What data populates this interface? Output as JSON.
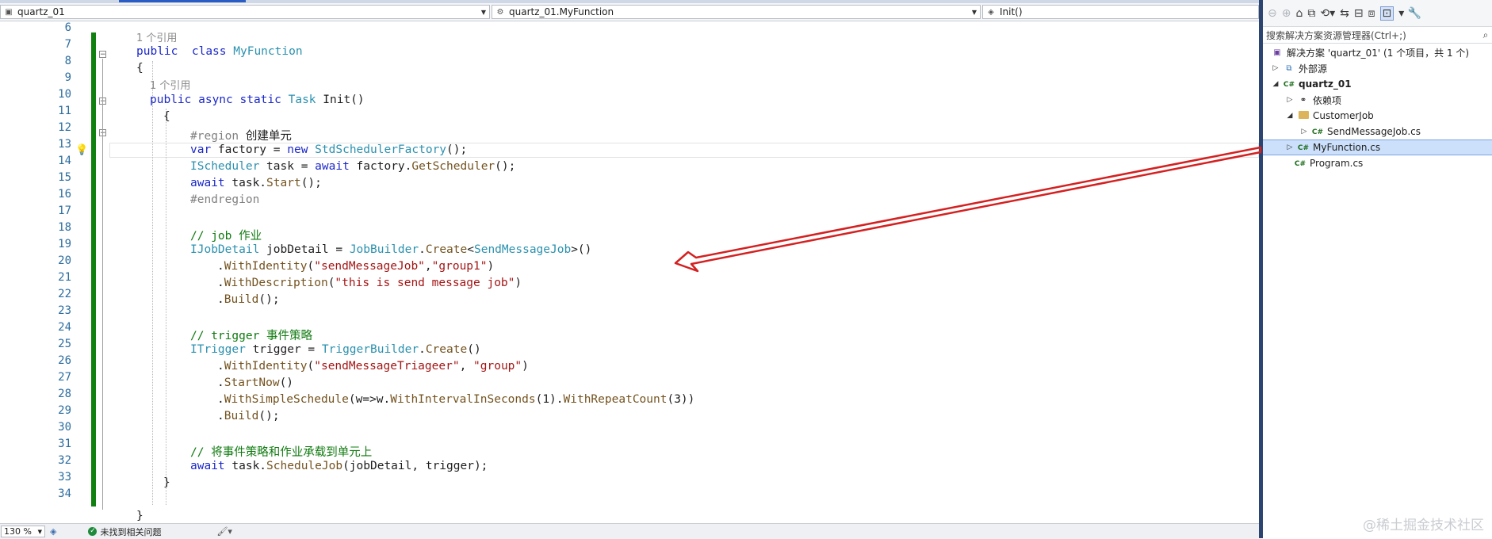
{
  "nav": {
    "project": "quartz_01",
    "class": "quartz_01.MyFunction",
    "member": "Init()"
  },
  "line_numbers": [
    "6",
    "7",
    "8",
    "9",
    "10",
    "11",
    "12",
    "13",
    "14",
    "15",
    "16",
    "17",
    "18",
    "19",
    "20",
    "21",
    "22",
    "23",
    "24",
    "25",
    "26",
    "27",
    "28",
    "29",
    "30",
    "31",
    "32",
    "33",
    "34"
  ],
  "code": {
    "ref1": "1 个引用",
    "l7_kw": "public",
    "l7_kw2": "class",
    "l7_type": "MyFunction",
    "l8": "{",
    "ref2": "1 个引用",
    "l9_a": "public async static",
    "l9_type": "Task",
    "l9_rest": " Init()",
    "l10": "{",
    "l11_region": "#region",
    "l11_text": "创建单元",
    "l12_kw": "var",
    "l12_a": " factory = ",
    "l12_new": "new",
    "l12_type": "StdSchedulerFactory",
    "l12_end": "();",
    "l13_type": "IScheduler",
    "l13_a": " task = ",
    "l13_await": "await",
    "l13_b": " factory.",
    "l13_m": "GetScheduler",
    "l13_end": "();",
    "l14_await": "await",
    "l14_a": " task.",
    "l14_m": "Start",
    "l14_end": "();",
    "l15": "#endregion",
    "l17": "// job 作业",
    "l18_type": "IJobDetail",
    "l18_a": " jobDetail = ",
    "l18_type2": "JobBuilder",
    "l18_b": ".",
    "l18_m": "Create",
    "l18_lt": "<",
    "l18_type3": "SendMessageJob",
    "l18_end": ">()",
    "l19_a": ".",
    "l19_m": "WithIdentity",
    "l19_s1": "\"sendMessageJob\"",
    "l19_s2": "\"group1\"",
    "l20_a": ".",
    "l20_m": "WithDescription",
    "l20_s": "\"this is send message job\"",
    "l21_a": ".",
    "l21_m": "Build",
    "l21_end": "();",
    "l23": "// trigger 事件策略",
    "l24_type": "ITrigger",
    "l24_a": " trigger = ",
    "l24_type2": "TriggerBuilder",
    "l24_b": ".",
    "l24_m": "Create",
    "l24_end": "()",
    "l25_a": ".",
    "l25_m": "WithIdentity",
    "l25_s1": "\"sendMessageTriageer\"",
    "l25_s2": "\"group\"",
    "l26_a": ".",
    "l26_m": "StartNow",
    "l26_end": "()",
    "l27_a": ".",
    "l27_m": "WithSimpleSchedule",
    "l27_b": "(w=>w.",
    "l27_m2": "WithIntervalInSeconds",
    "l27_c": "(1).",
    "l27_m3": "WithRepeatCount",
    "l27_d": "(3))",
    "l28_a": ".",
    "l28_m": "Build",
    "l28_end": "();",
    "l30": "// 将事件策略和作业承载到单元上",
    "l31_await": "await",
    "l31_a": " task.",
    "l31_m": "ScheduleJob",
    "l31_b": "(jobDetail, trigger);",
    "l32": "}",
    "l34": "}"
  },
  "status": {
    "zoom": "130 %",
    "issues": "未找到相关问题"
  },
  "panel": {
    "search_placeholder": "搜索解决方案资源管理器(Ctrl+;)",
    "solution": "解决方案 'quartz_01' (1 个项目，共 1 个)",
    "items": [
      {
        "label": "外部源"
      },
      {
        "label": "quartz_01"
      },
      {
        "label": "依赖项"
      },
      {
        "label": "CustomerJob"
      },
      {
        "label": "SendMessageJob.cs"
      },
      {
        "label": "MyFunction.cs"
      },
      {
        "label": "Program.cs"
      }
    ]
  },
  "watermark": "@稀土掘金技术社区",
  "colors": {
    "keyword": "#1b28c9",
    "type": "#2b91af",
    "comment": "#0f7a0f",
    "string": "#a31515",
    "method": "#74531f",
    "change_bar": "#108010",
    "arrow": "#d42020",
    "selection": "#cce0fb"
  }
}
